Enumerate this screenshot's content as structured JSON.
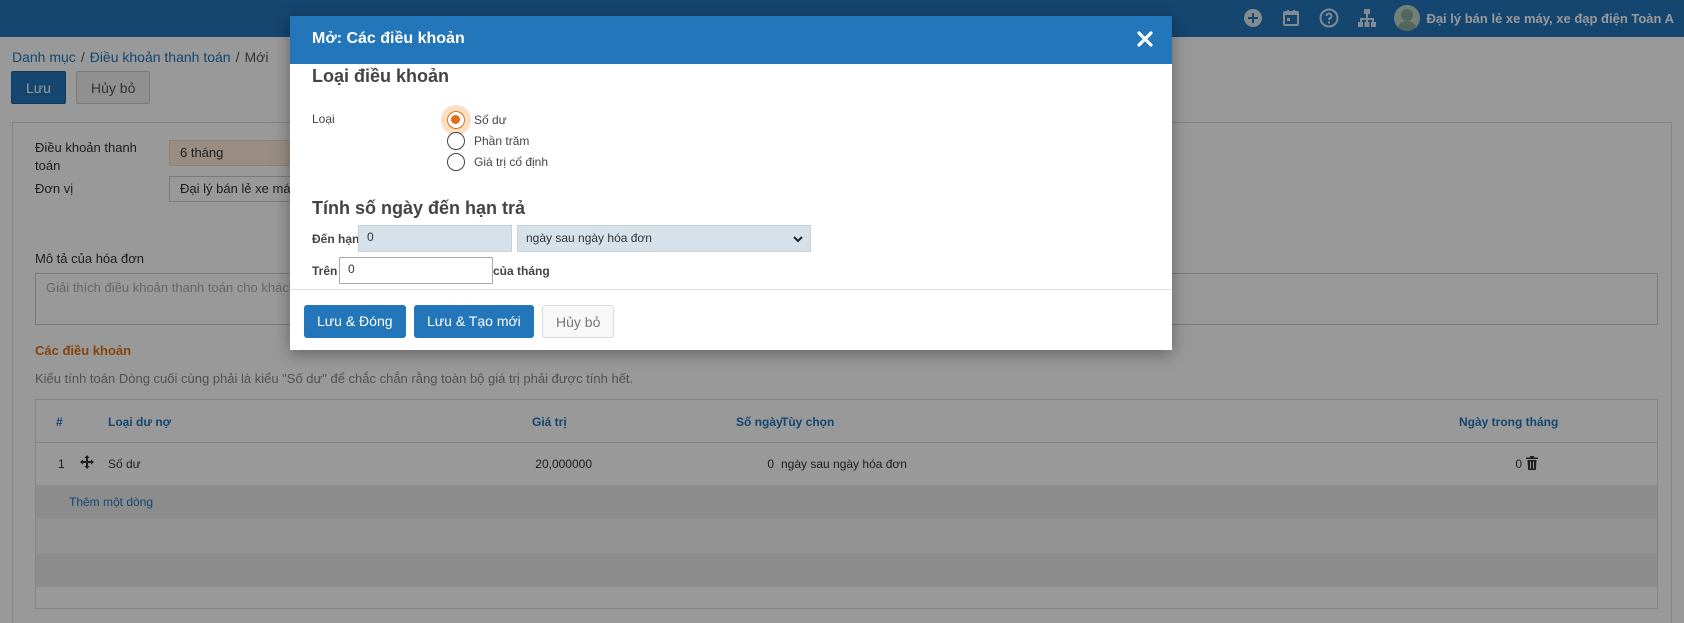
{
  "header": {
    "user_name": "Đại lý bán lẻ xe máy, xe đạp điện Toàn A"
  },
  "breadcrumb": {
    "item1": "Danh mục",
    "item2": "Điều khoản thanh toán",
    "item3": "Mới",
    "sep": "/"
  },
  "toolbar": {
    "save_label": "Lưu",
    "discard_label": "Hủy bỏ"
  },
  "form": {
    "term_label": "Điều khoản thanh toán",
    "term_value": "6 tháng",
    "company_label": "Đơn vị",
    "company_value": "Đại lý bán lẻ xe máy",
    "invoice_desc_label": "Mô tả của hóa đơn",
    "invoice_desc_placeholder": "Giải thích điều khoản thanh toán cho khách",
    "terms_section": "Các điều khoản",
    "terms_hint": "Kiểu tính toán Dòng cuối cùng phải là kiểu \"Số dư\" để chắc chắn rằng toàn bộ giá trị phải được tính hết."
  },
  "grid": {
    "headers": {
      "num": "#",
      "type": "Loại dư nợ",
      "value": "Giá trị",
      "days": "Số ngày",
      "option": "Tùy chọn",
      "day_of_month": "Ngày trong tháng"
    },
    "rows": [
      {
        "num": "1",
        "type": "Số dư",
        "value": "20,000000",
        "days": "0",
        "option": "ngày sau ngày hóa đơn",
        "day_of_month": "0"
      }
    ],
    "add_line": "Thêm một dòng"
  },
  "modal": {
    "title": "Mở: Các điều khoản",
    "section1": "Loại điều khoản",
    "type_label": "Loại",
    "options": [
      {
        "label": "Số dư",
        "checked": true
      },
      {
        "label": "Phần trăm",
        "checked": false
      },
      {
        "label": "Giá trị cố định",
        "checked": false
      }
    ],
    "section2": "Tính số ngày đến hạn trả",
    "due_label": "Đến hạn",
    "due_value": "0",
    "due_option": "ngày sau ngày hóa đơn",
    "on_label": "Trên",
    "on_value": "0",
    "of_month_label": "của tháng",
    "btn_save_close": "Lưu & Đóng",
    "btn_save_new": "Lưu & Tạo mới",
    "btn_discard": "Hủy bỏ"
  },
  "colors": {
    "primary": "#2476bb",
    "accent_orange": "#e07015"
  }
}
